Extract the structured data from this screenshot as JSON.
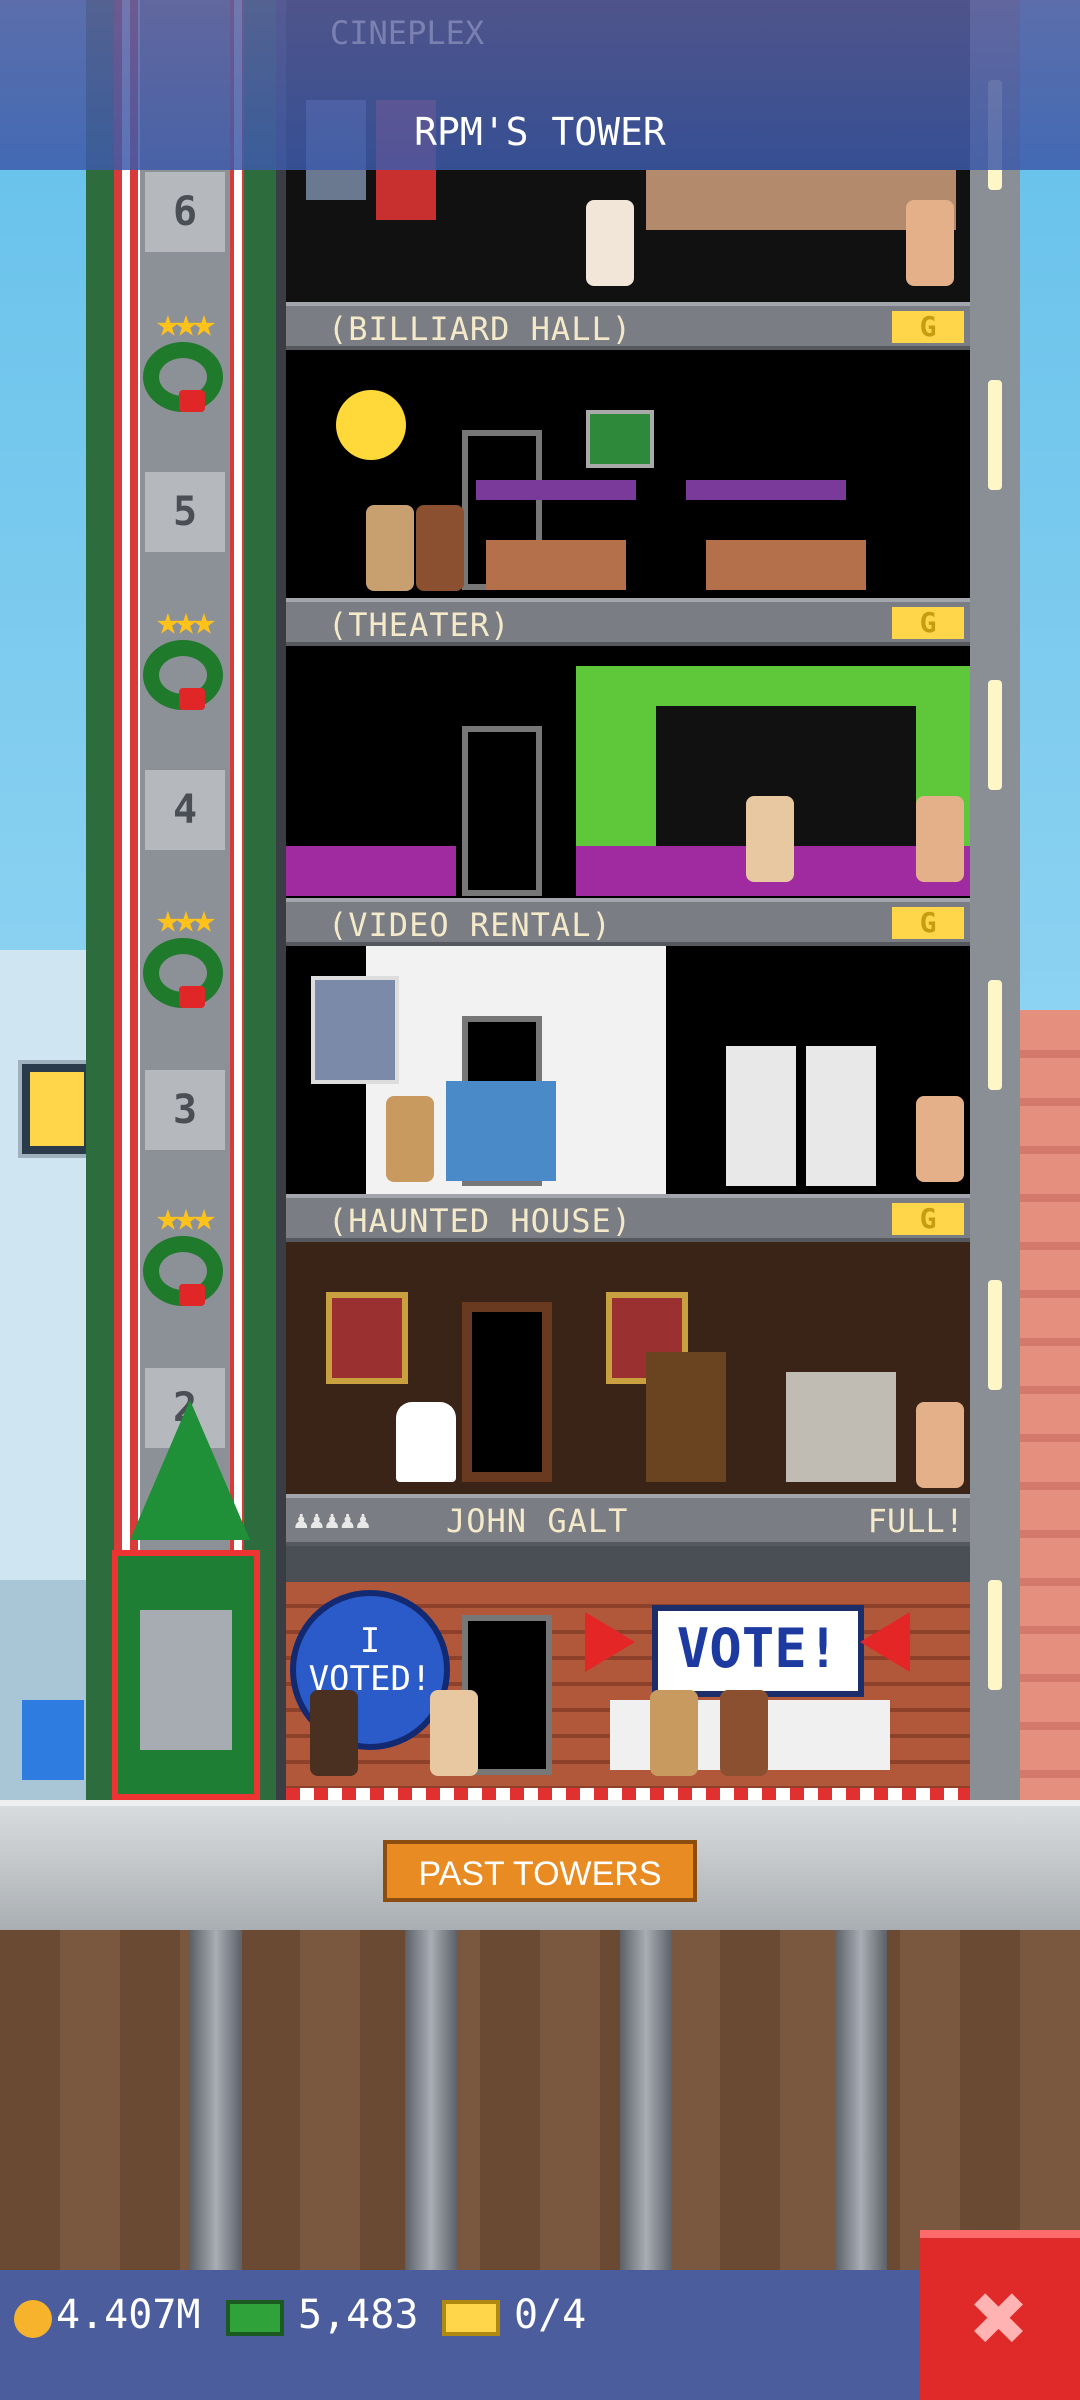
{
  "header": {
    "ghost_label": "CINEPLEX",
    "title": "RPM'S TOWER"
  },
  "elevator": {
    "floor_numbers": [
      "6",
      "5",
      "4",
      "3",
      "2"
    ]
  },
  "floors": [
    {
      "name": "(BILLIARD HALL)",
      "badge": "G"
    },
    {
      "name": "(THEATER)",
      "badge": "G"
    },
    {
      "name": "(VIDEO RENTAL)",
      "badge": "G"
    },
    {
      "name": "(HAUNTED HOUSE)",
      "badge": "G"
    }
  ],
  "lobby_label": {
    "residents": "♟♟♟♟♟",
    "owner": "JOHN GALT",
    "status": "FULL!"
  },
  "lobby": {
    "voted_badge": "I VOTED!",
    "vote_sign": "VOTE!"
  },
  "buttons": {
    "past_towers": "PAST TOWERS",
    "close": "✖"
  },
  "stats": {
    "coins": "4.407M",
    "bux": "5,483",
    "tickets": "0/4"
  },
  "colors": {
    "accent_close": "#e02a2a",
    "button_orange": "#e88b22",
    "stat_bar": "#4b5d9c"
  }
}
